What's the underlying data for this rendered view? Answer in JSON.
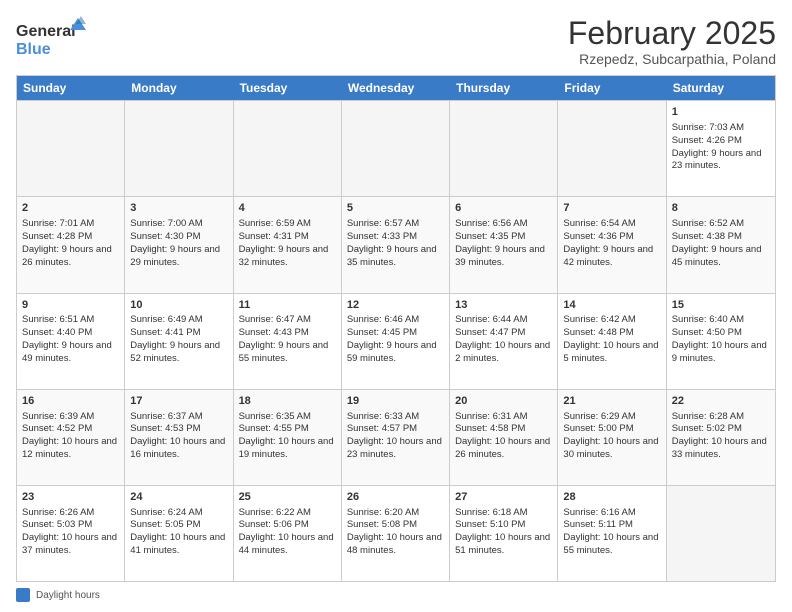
{
  "logo": {
    "line1": "General",
    "line2": "Blue"
  },
  "title": "February 2025",
  "subtitle": "Rzepedz, Subcarpathia, Poland",
  "days": [
    "Sunday",
    "Monday",
    "Tuesday",
    "Wednesday",
    "Thursday",
    "Friday",
    "Saturday"
  ],
  "weeks": [
    [
      {
        "day": "",
        "info": ""
      },
      {
        "day": "",
        "info": ""
      },
      {
        "day": "",
        "info": ""
      },
      {
        "day": "",
        "info": ""
      },
      {
        "day": "",
        "info": ""
      },
      {
        "day": "",
        "info": ""
      },
      {
        "day": "1",
        "info": "Sunrise: 7:03 AM\nSunset: 4:26 PM\nDaylight: 9 hours and 23 minutes."
      }
    ],
    [
      {
        "day": "2",
        "info": "Sunrise: 7:01 AM\nSunset: 4:28 PM\nDaylight: 9 hours and 26 minutes."
      },
      {
        "day": "3",
        "info": "Sunrise: 7:00 AM\nSunset: 4:30 PM\nDaylight: 9 hours and 29 minutes."
      },
      {
        "day": "4",
        "info": "Sunrise: 6:59 AM\nSunset: 4:31 PM\nDaylight: 9 hours and 32 minutes."
      },
      {
        "day": "5",
        "info": "Sunrise: 6:57 AM\nSunset: 4:33 PM\nDaylight: 9 hours and 35 minutes."
      },
      {
        "day": "6",
        "info": "Sunrise: 6:56 AM\nSunset: 4:35 PM\nDaylight: 9 hours and 39 minutes."
      },
      {
        "day": "7",
        "info": "Sunrise: 6:54 AM\nSunset: 4:36 PM\nDaylight: 9 hours and 42 minutes."
      },
      {
        "day": "8",
        "info": "Sunrise: 6:52 AM\nSunset: 4:38 PM\nDaylight: 9 hours and 45 minutes."
      }
    ],
    [
      {
        "day": "9",
        "info": "Sunrise: 6:51 AM\nSunset: 4:40 PM\nDaylight: 9 hours and 49 minutes."
      },
      {
        "day": "10",
        "info": "Sunrise: 6:49 AM\nSunset: 4:41 PM\nDaylight: 9 hours and 52 minutes."
      },
      {
        "day": "11",
        "info": "Sunrise: 6:47 AM\nSunset: 4:43 PM\nDaylight: 9 hours and 55 minutes."
      },
      {
        "day": "12",
        "info": "Sunrise: 6:46 AM\nSunset: 4:45 PM\nDaylight: 9 hours and 59 minutes."
      },
      {
        "day": "13",
        "info": "Sunrise: 6:44 AM\nSunset: 4:47 PM\nDaylight: 10 hours and 2 minutes."
      },
      {
        "day": "14",
        "info": "Sunrise: 6:42 AM\nSunset: 4:48 PM\nDaylight: 10 hours and 5 minutes."
      },
      {
        "day": "15",
        "info": "Sunrise: 6:40 AM\nSunset: 4:50 PM\nDaylight: 10 hours and 9 minutes."
      }
    ],
    [
      {
        "day": "16",
        "info": "Sunrise: 6:39 AM\nSunset: 4:52 PM\nDaylight: 10 hours and 12 minutes."
      },
      {
        "day": "17",
        "info": "Sunrise: 6:37 AM\nSunset: 4:53 PM\nDaylight: 10 hours and 16 minutes."
      },
      {
        "day": "18",
        "info": "Sunrise: 6:35 AM\nSunset: 4:55 PM\nDaylight: 10 hours and 19 minutes."
      },
      {
        "day": "19",
        "info": "Sunrise: 6:33 AM\nSunset: 4:57 PM\nDaylight: 10 hours and 23 minutes."
      },
      {
        "day": "20",
        "info": "Sunrise: 6:31 AM\nSunset: 4:58 PM\nDaylight: 10 hours and 26 minutes."
      },
      {
        "day": "21",
        "info": "Sunrise: 6:29 AM\nSunset: 5:00 PM\nDaylight: 10 hours and 30 minutes."
      },
      {
        "day": "22",
        "info": "Sunrise: 6:28 AM\nSunset: 5:02 PM\nDaylight: 10 hours and 33 minutes."
      }
    ],
    [
      {
        "day": "23",
        "info": "Sunrise: 6:26 AM\nSunset: 5:03 PM\nDaylight: 10 hours and 37 minutes."
      },
      {
        "day": "24",
        "info": "Sunrise: 6:24 AM\nSunset: 5:05 PM\nDaylight: 10 hours and 41 minutes."
      },
      {
        "day": "25",
        "info": "Sunrise: 6:22 AM\nSunset: 5:06 PM\nDaylight: 10 hours and 44 minutes."
      },
      {
        "day": "26",
        "info": "Sunrise: 6:20 AM\nSunset: 5:08 PM\nDaylight: 10 hours and 48 minutes."
      },
      {
        "day": "27",
        "info": "Sunrise: 6:18 AM\nSunset: 5:10 PM\nDaylight: 10 hours and 51 minutes."
      },
      {
        "day": "28",
        "info": "Sunrise: 6:16 AM\nSunset: 5:11 PM\nDaylight: 10 hours and 55 minutes."
      },
      {
        "day": "",
        "info": ""
      }
    ]
  ],
  "legend": {
    "color": "#3a7bc8",
    "label": "Daylight hours"
  }
}
